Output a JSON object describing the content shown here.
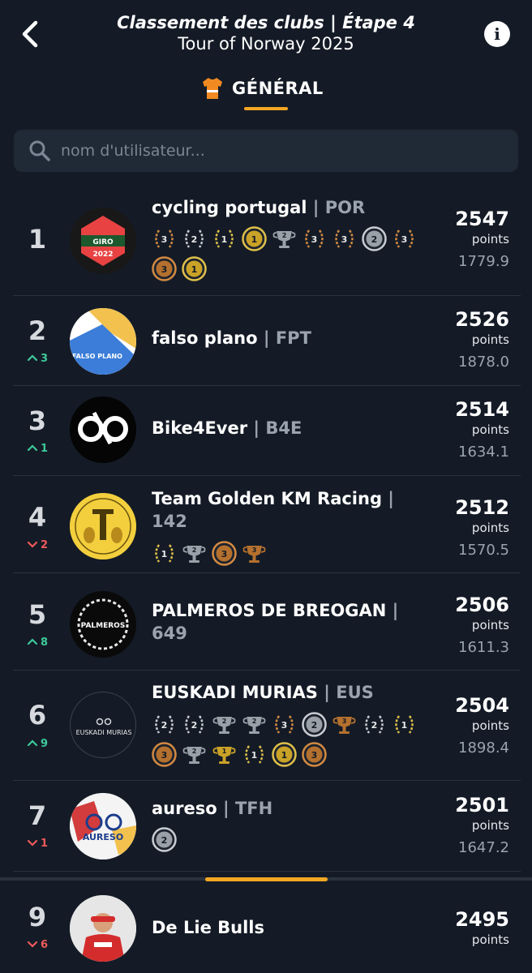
{
  "header": {
    "title": "Classement des clubs | Étape 4",
    "subtitle": "Tour of Norway 2025",
    "tab_label": "GÉNÉRAL",
    "back_icon": "chevron-left-icon",
    "info_icon": "info-icon",
    "info_glyph": "i"
  },
  "search": {
    "placeholder": "nom d'utilisateur...",
    "value": ""
  },
  "colors": {
    "accent": "#f5a623",
    "background": "#141b26",
    "up": "#3ec99a",
    "down": "#f05a5a",
    "muted": "#9aa3ae"
  },
  "rows": [
    {
      "rank": "1",
      "move": "",
      "name": "cycling portugal",
      "code": "POR",
      "points": "2547",
      "points_label": "points",
      "sub": "1779.9",
      "badges": [
        "laurel-3",
        "laurel-2",
        "laurel-1",
        "medal-gold-1",
        "trophy-silver-2",
        "laurel-3",
        "laurel-3",
        "medal-silver-2",
        "laurel-3",
        "medal-bronze-3",
        "medal-gold-1"
      ]
    },
    {
      "rank": "2",
      "move": "^3",
      "name": "falso plano",
      "code": "FPT",
      "points": "2526",
      "points_label": "points",
      "sub": "1878.0",
      "badges": []
    },
    {
      "rank": "3",
      "move": "^1",
      "name": "Bike4Ever",
      "code": "B4E",
      "points": "2514",
      "points_label": "points",
      "sub": "1634.1",
      "badges": []
    },
    {
      "rank": "4",
      "move": "v2",
      "name": "Team Golden KM Racing",
      "code": "142",
      "points": "2512",
      "points_label": "points",
      "sub": "1570.5",
      "badges": [
        "laurel-1",
        "trophy-silver-2",
        "medal-bronze-3",
        "trophy-bronze-3"
      ]
    },
    {
      "rank": "5",
      "move": "^8",
      "name": "PALMEROS DE BREOGAN",
      "code": "649",
      "points": "2506",
      "points_label": "points",
      "sub": "1611.3",
      "badges": []
    },
    {
      "rank": "6",
      "move": "^9",
      "name": "EUSKADI MURIAS",
      "code": "EUS",
      "points": "2504",
      "points_label": "points",
      "sub": "1898.4",
      "badges": [
        "laurel-2",
        "laurel-2",
        "trophy-silver-2",
        "trophy-silver-2",
        "laurel-3",
        "medal-silver-2",
        "trophy-bronze-3",
        "laurel-2",
        "laurel-1",
        "medal-bronze-3",
        "trophy-silver-2",
        "trophy-gold-1",
        "laurel-1",
        "medal-gold-1",
        "medal-bronze-3"
      ]
    },
    {
      "rank": "7",
      "move": "v1",
      "name": "aureso",
      "code": "TFH",
      "points": "2501",
      "points_label": "points",
      "sub": "1647.2",
      "badges": [
        "medal-silver-2"
      ]
    }
  ],
  "my_row": {
    "rank": "9",
    "move": "v6",
    "name": "De Lie Bulls",
    "points": "2495",
    "points_label": "points"
  },
  "avatars": {
    "r1": {
      "text": "2022",
      "banner": "GIRO"
    },
    "r2": {
      "text": "FALSO PLANO"
    },
    "r5": {
      "text": "PALMEROS"
    },
    "r6": {
      "text": "EUSKADI MURIAS"
    },
    "r7": {
      "text": "AURESO"
    }
  }
}
